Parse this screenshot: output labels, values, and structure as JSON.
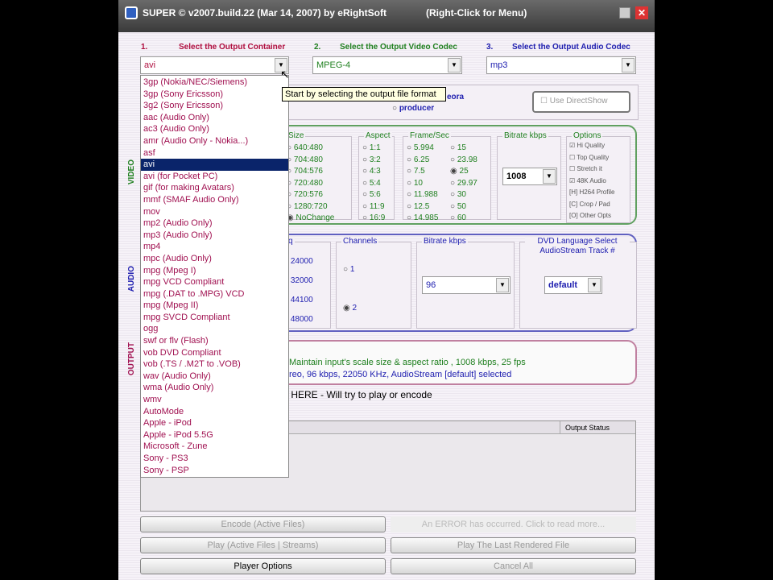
{
  "window": {
    "title": "SUPER © v2007.build.22 (Mar 14, 2007) by eRightSoft",
    "menu_hint": "(Right-Click for Menu)"
  },
  "steps": [
    {
      "num": "1.",
      "label": "Select the Output Container",
      "value": "avi",
      "color": "#b01040"
    },
    {
      "num": "2.",
      "label": "Select the Output Video Codec",
      "value": "MPEG-4",
      "color": "#208020"
    },
    {
      "num": "3.",
      "label": "Select the Output Audio Codec",
      "value": "mp3",
      "color": "#2020b0"
    }
  ],
  "tooltip": "Start by selecting the output file format",
  "encoder_row": {
    "partial_label": "eora",
    "producer": "producer",
    "direct_show": "Use DirectShow"
  },
  "container_options": [
    "3gp  (Nokia/NEC/Siemens)",
    "3gp  (Sony Ericsson)",
    "3g2  (Sony Ericsson)",
    "aac  (Audio Only)",
    "ac3  (Audio Only)",
    "amr (Audio Only - Nokia...)",
    "asf",
    "avi",
    "avi  (for Pocket PC)",
    "gif  (for making Avatars)",
    "mmf  (SMAF Audio Only)",
    "mov",
    "mp2  (Audio Only)",
    "mp3  (Audio Only)",
    "mp4",
    "mpc  (Audio Only)",
    "mpg  (Mpeg I)",
    "mpg  VCD Compliant",
    "mpg  (.DAT to .MPG) VCD",
    "mpg  (Mpeg II)",
    "mpg  SVCD Compliant",
    "ogg",
    "swf or flv (Flash)",
    "vob  DVD Compliant",
    "vob  (.TS / .M2T to .VOB)",
    "wav (Audio Only)",
    "wma (Audio Only)",
    "wmv",
    "AutoMode",
    "Apple - iPod",
    "Apple - iPod 5.5G",
    "Microsoft - Zune",
    "Sony - PS3",
    "Sony - PSP"
  ],
  "selected_container_index": 7,
  "video": {
    "label": "VIDEO",
    "size": {
      "title": "Size",
      "options": [
        "640:480",
        "704:480",
        "704:576",
        "720:480",
        "720:576",
        "1280:720",
        "NoChange"
      ],
      "selected": "NoChange"
    },
    "aspect": {
      "title": "Aspect",
      "options": [
        "1:1",
        "3:2",
        "4:3",
        "5:4",
        "5:6",
        "11:9",
        "16:9"
      ]
    },
    "fps": {
      "title": "Frame/Sec",
      "options": [
        "5.994",
        "6.25",
        "7.5",
        "10",
        "11.988",
        "12.5",
        "14.985",
        "15",
        "23.98",
        "25",
        "29.97",
        "30",
        "50",
        "60"
      ],
      "selected": "25"
    },
    "bitrate": {
      "title": "Bitrate  kbps",
      "value": "1008"
    },
    "options": {
      "title": "Options",
      "items": [
        {
          "label": "Hi Quality",
          "checked": true
        },
        {
          "label": "Top Quality",
          "checked": false
        },
        {
          "label": "Stretch it",
          "checked": false
        },
        {
          "label": "48K Audio",
          "checked": true
        },
        {
          "label": "H264 Profile",
          "key": "H"
        },
        {
          "label": "Crop / Pad",
          "key": "C"
        },
        {
          "label": "Other Opts",
          "key": "O"
        }
      ]
    }
  },
  "audio": {
    "label": "AUDIO",
    "freq": {
      "title": "q",
      "options": [
        "24000",
        "32000",
        "44100",
        "48000"
      ]
    },
    "channels": {
      "title": "Channels",
      "options": [
        "1",
        "2"
      ],
      "selected": "2"
    },
    "bitrate": {
      "title": "Bitrate  kbps",
      "value": "96"
    },
    "dvd": {
      "title": "DVD Language Select AudioStream  Track #",
      "value": "default"
    }
  },
  "output": {
    "label": "OUTPUT",
    "video_line": "Maintain input's scale size & aspect ratio ,  1008 kbps,  25 fps",
    "audio_line": "reo,  96 kbps,  22050 KHz,  AudioStream [default] selected"
  },
  "drop_hint": "E HERE - Will try to play or encode",
  "file_list": {
    "status_header": "Output Status"
  },
  "buttons": {
    "encode": "Encode (Active Files)",
    "error": "An ERROR has occurred. Click to read more...",
    "play": "Play (Active Files | Streams)",
    "play_last": "Play The Last Rendered File",
    "player_options": "Player Options",
    "cancel_all": "Cancel All"
  }
}
